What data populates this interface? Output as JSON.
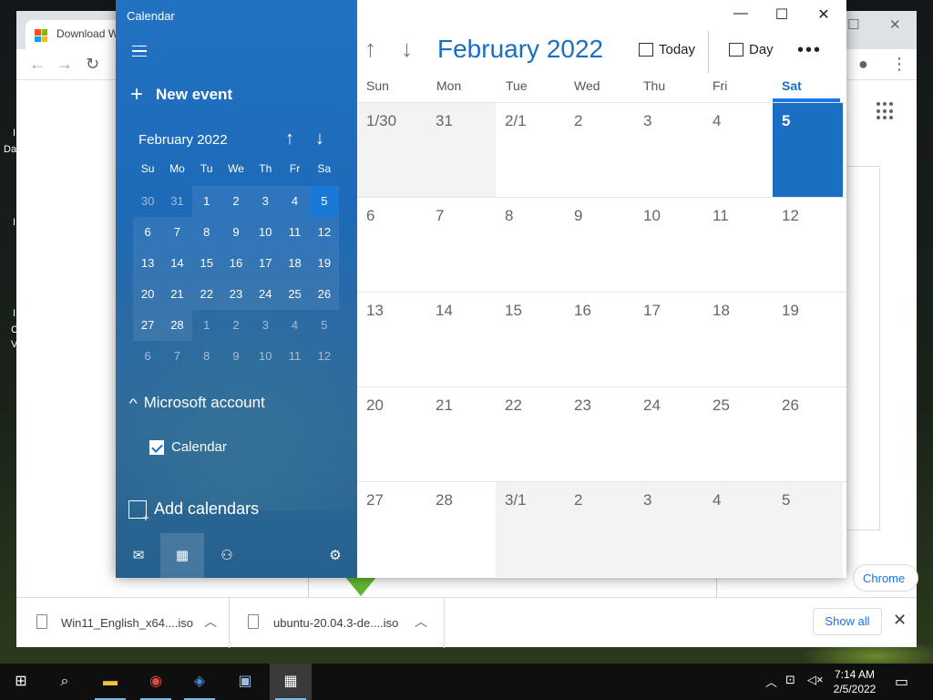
{
  "browser": {
    "tab_title": "Download W",
    "downloads": [
      {
        "name": "Win11_English_x64....iso"
      },
      {
        "name": "ubuntu-20.04.3-de....iso"
      }
    ],
    "show_all_label": "Show all",
    "chrome_button_label": "Chrome"
  },
  "desktop": {
    "icon_fragments": [
      "I",
      "Da",
      "I",
      "I",
      "C",
      "V"
    ]
  },
  "calendar": {
    "app_title": "Calendar",
    "new_event_label": "New event",
    "mini": {
      "title": "February 2022",
      "weekday_heads": [
        "Su",
        "Mo",
        "Tu",
        "We",
        "Th",
        "Fr",
        "Sa"
      ],
      "weeks": [
        [
          "30",
          "31",
          "1",
          "2",
          "3",
          "4",
          "5"
        ],
        [
          "6",
          "7",
          "8",
          "9",
          "10",
          "11",
          "12"
        ],
        [
          "13",
          "14",
          "15",
          "16",
          "17",
          "18",
          "19"
        ],
        [
          "20",
          "21",
          "22",
          "23",
          "24",
          "25",
          "26"
        ],
        [
          "27",
          "28",
          "1",
          "2",
          "3",
          "4",
          "5"
        ],
        [
          "6",
          "7",
          "8",
          "9",
          "10",
          "11",
          "12"
        ]
      ]
    },
    "account_label": "Microsoft account",
    "calendar_label": "Calendar",
    "add_calendars_label": "Add calendars",
    "month_title": "February 2022",
    "today_label": "Today",
    "view_label": "Day",
    "more_label": "•••",
    "day_headers": [
      "Sun",
      "Mon",
      "Tue",
      "Wed",
      "Thu",
      "Fri",
      "Sat"
    ],
    "month_grid": [
      [
        "1/30",
        "31",
        "2/1",
        "2",
        "3",
        "4",
        "5"
      ],
      [
        "6",
        "7",
        "8",
        "9",
        "10",
        "11",
        "12"
      ],
      [
        "13",
        "14",
        "15",
        "16",
        "17",
        "18",
        "19"
      ],
      [
        "20",
        "21",
        "22",
        "23",
        "24",
        "25",
        "26"
      ],
      [
        "27",
        "28",
        "3/1",
        "2",
        "3",
        "4",
        "5"
      ]
    ],
    "accent_color": "#1a6fc3"
  },
  "taskbar": {
    "time": "7:14 AM",
    "date": "2/5/2022"
  }
}
